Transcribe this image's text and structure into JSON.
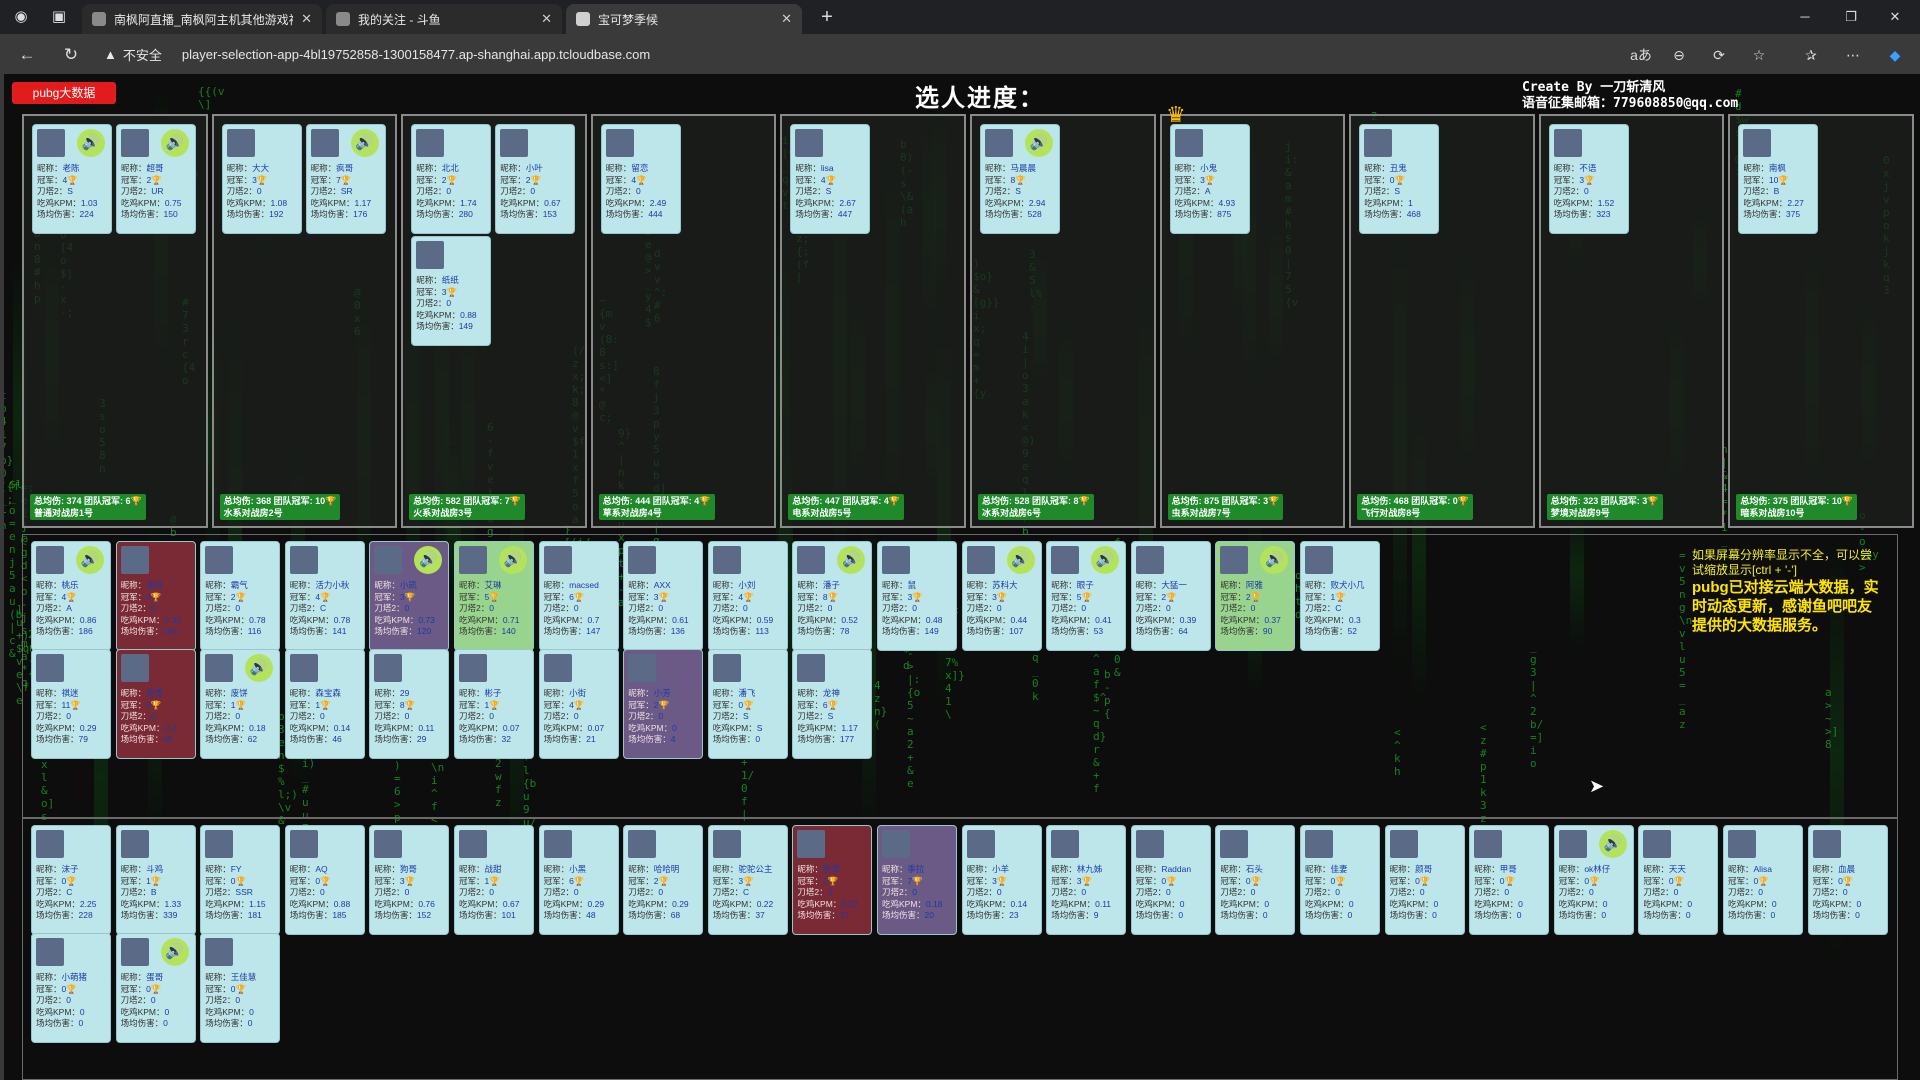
{
  "browser": {
    "tabs": [
      {
        "title": "南枫阿直播_南枫阿主机其他游戏视",
        "active": false
      },
      {
        "title": "我的关注 - 斗鱼",
        "active": false
      },
      {
        "title": "宝可梦季候",
        "active": true
      }
    ],
    "insecure_label": "不安全",
    "url": "player-selection-app-4bl19752858-1300158477.ap-shanghai.app.tcloudbase.com",
    "reader_label": "aあ"
  },
  "page": {
    "pubg_button": "pubg大数据",
    "heading": "选人进度：",
    "credit_line1": "Create By 一刀斩清风",
    "credit_line2": "语音征集邮箱：779608850@qq.com",
    "notice_line": "如果屏幕分辨率显示不全，可以尝试缩放显示[ctrl + '-']",
    "notice_big": "pubg已对接云端大数据，实时动态更新，感谢鱼吧吧友提供的大数据服务。",
    "colors": {
      "accent_green": "#1e8a2a",
      "card_bg": "#bde6ea",
      "pubg_red": "#e21c1c"
    }
  },
  "labels": {
    "nick": "昵称：",
    "crown": "冠军：",
    "tower": "刀塔2：",
    "kpm": "吃鸡KPM：",
    "dmg": "场均伤害："
  },
  "teams": [
    {
      "footer": "总均伤: 374 团队冠军: 6🏆",
      "name": "普通对战房1号",
      "players": [
        {
          "nick": "老陈",
          "crown": "4",
          "tower": "S",
          "kpm": "1.03",
          "dmg": "224",
          "voice": true
        },
        {
          "nick": "超哥",
          "crown": "2",
          "tower": "UR",
          "kpm": "0.75",
          "dmg": "150",
          "voice": true
        }
      ]
    },
    {
      "footer": "总均伤: 368 团队冠军: 10🏆",
      "name": "水系对战房2号",
      "players": [
        {
          "nick": "大大",
          "crown": "3",
          "tower": "0",
          "kpm": "1.08",
          "dmg": "192",
          "voice": false
        },
        {
          "nick": "疯哥",
          "crown": "7",
          "tower": "SR",
          "kpm": "1.17",
          "dmg": "176",
          "voice": true
        }
      ]
    },
    {
      "footer": "总均伤: 582 团队冠军: 7🏆",
      "name": "火系对战房3号",
      "players": [
        {
          "nick": "北北",
          "crown": "2",
          "tower": "0",
          "kpm": "1.74",
          "dmg": "280",
          "voice": false
        },
        {
          "nick": "小叶",
          "crown": "2",
          "tower": "0",
          "kpm": "0.67",
          "dmg": "153",
          "voice": false
        },
        {
          "nick": "纸纸",
          "crown": "3",
          "tower": "0",
          "kpm": "0.88",
          "dmg": "149",
          "voice": false
        }
      ]
    },
    {
      "footer": "总均伤: 444 团队冠军: 4🏆",
      "name": "草系对战房4号",
      "players": [
        {
          "nick": "留恋",
          "crown": "4",
          "tower": "0",
          "kpm": "2.49",
          "dmg": "444",
          "voice": false
        }
      ]
    },
    {
      "footer": "总均伤: 447 团队冠军: 4🏆",
      "name": "电系对战房5号",
      "players": [
        {
          "nick": "lisa",
          "crown": "4",
          "tower": "S",
          "kpm": "2.67",
          "dmg": "447",
          "voice": false
        }
      ]
    },
    {
      "footer": "总均伤: 528 团队冠军: 8🏆",
      "name": "冰系对战房6号",
      "players": [
        {
          "nick": "马晨晨",
          "crown": "8",
          "tower": "S",
          "kpm": "2.94",
          "dmg": "528",
          "voice": true
        }
      ]
    },
    {
      "footer": "总均伤: 875 团队冠军: 3🏆",
      "name": "虫系对战房7号",
      "players": [
        {
          "nick": "小鬼",
          "crown": "3",
          "tower": "A",
          "kpm": "4.93",
          "dmg": "875",
          "voice": false
        }
      ]
    },
    {
      "footer": "总均伤: 468 团队冠军: 0🏆",
      "name": "飞行对战房8号",
      "players": [
        {
          "nick": "丑鬼",
          "crown": "0",
          "tower": "S",
          "kpm": "1",
          "dmg": "468",
          "voice": false
        }
      ]
    },
    {
      "footer": "总均伤: 323 团队冠军: 3🏆",
      "name": "梦境对战房9号",
      "players": [
        {
          "nick": "不语",
          "crown": "3",
          "tower": "0",
          "kpm": "1.52",
          "dmg": "323",
          "voice": false
        }
      ]
    },
    {
      "footer": "总均伤: 375 团队冠军: 10🏆",
      "name": "暗系对战房10号",
      "players": [
        {
          "nick": "南枫",
          "crown": "10",
          "tower": "B",
          "kpm": "2.27",
          "dmg": "375",
          "voice": false
        }
      ]
    }
  ],
  "pool": [
    {
      "nick": "桃乐",
      "crown": "4",
      "tower": "A",
      "kpm": "0.86",
      "dmg": "186",
      "voice": true
    },
    {
      "nick": "电竞",
      "crown": "6",
      "tower": "0",
      "kpm": "0.35",
      "dmg": "166",
      "voice": false,
      "style": "dark"
    },
    {
      "nick": "霸气",
      "crown": "2",
      "tower": "0",
      "kpm": "0.78",
      "dmg": "116",
      "voice": false
    },
    {
      "nick": "活力小秋",
      "crown": "4",
      "tower": "C",
      "kpm": "0.78",
      "dmg": "141",
      "voice": false
    },
    {
      "nick": "小凯",
      "crown": "3",
      "tower": "0",
      "kpm": "0.73",
      "dmg": "120",
      "voice": true,
      "style": "purple"
    },
    {
      "nick": "艾琳",
      "crown": "5",
      "tower": "0",
      "kpm": "0.71",
      "dmg": "140",
      "voice": true,
      "style": "green"
    },
    {
      "nick": "macsed",
      "crown": "6",
      "tower": "0",
      "kpm": "0.7",
      "dmg": "147",
      "voice": false
    },
    {
      "nick": "AXX",
      "crown": "3",
      "tower": "0",
      "kpm": "0.61",
      "dmg": "136",
      "voice": false
    },
    {
      "nick": "小刘",
      "crown": "4",
      "tower": "0",
      "kpm": "0.59",
      "dmg": "113",
      "voice": false
    },
    {
      "nick": "潘子",
      "crown": "8",
      "tower": "0",
      "kpm": "0.52",
      "dmg": "78",
      "voice": true
    },
    {
      "nick": "鼠",
      "crown": "3",
      "tower": "0",
      "kpm": "0.48",
      "dmg": "149",
      "voice": false
    },
    {
      "nick": "苏科大",
      "crown": "3",
      "tower": "0",
      "kpm": "0.44",
      "dmg": "107",
      "voice": true
    },
    {
      "nick": "眼子",
      "crown": "5",
      "tower": "0",
      "kpm": "0.41",
      "dmg": "53",
      "voice": true
    },
    {
      "nick": "大猛一",
      "crown": "2",
      "tower": "0",
      "kpm": "0.39",
      "dmg": "64",
      "voice": false
    },
    {
      "nick": "阿雅",
      "crown": "2",
      "tower": "0",
      "kpm": "0.37",
      "dmg": "90",
      "voice": true,
      "style": "green"
    },
    {
      "nick": "败犬小几",
      "crown": "1",
      "tower": "C",
      "kpm": "0.3",
      "dmg": "52",
      "voice": false
    },
    {
      "nick": "祺迷",
      "crown": "11",
      "tower": "0",
      "kpm": "0.29",
      "dmg": "79",
      "voice": false
    },
    {
      "nick": "炬哥",
      "crown": "3",
      "tower": "0",
      "kpm": "0.2",
      "dmg": "46",
      "voice": false,
      "style": "dark"
    },
    {
      "nick": "废饼",
      "crown": "1",
      "tower": "0",
      "kpm": "0.18",
      "dmg": "62",
      "voice": true
    },
    {
      "nick": "森宝森",
      "crown": "1",
      "tower": "0",
      "kpm": "0.14",
      "dmg": "46",
      "voice": false
    },
    {
      "nick": "29",
      "crown": "8",
      "tower": "0",
      "kpm": "0.11",
      "dmg": "29",
      "voice": false
    },
    {
      "nick": "彬子",
      "crown": "1",
      "tower": "0",
      "kpm": "0.07",
      "dmg": "32",
      "voice": false
    },
    {
      "nick": "小街",
      "crown": "4",
      "tower": "0",
      "kpm": "0.07",
      "dmg": "21",
      "voice": false
    },
    {
      "nick": "小芳",
      "crown": "2",
      "tower": "0",
      "kpm": "0",
      "dmg": "4",
      "voice": false,
      "style": "purple"
    },
    {
      "nick": "潘飞",
      "crown": "0",
      "tower": "S",
      "kpm": "S",
      "dmg": "0",
      "voice": false
    },
    {
      "nick": "龙神",
      "crown": "6",
      "tower": "S",
      "kpm": "1.17",
      "dmg": "177",
      "voice": false
    }
  ],
  "pool2": [
    {
      "nick": "沫子",
      "crown": "0",
      "tower": "C",
      "kpm": "2.25",
      "dmg": "228",
      "voice": false
    },
    {
      "nick": "斗鸡",
      "crown": "1",
      "tower": "B",
      "kpm": "1.33",
      "dmg": "339",
      "voice": false
    },
    {
      "nick": "FY",
      "crown": "0",
      "tower": "SSR",
      "kpm": "1.15",
      "dmg": "181",
      "voice": false
    },
    {
      "nick": "AQ",
      "crown": "0",
      "tower": "0",
      "kpm": "0.88",
      "dmg": "185",
      "voice": false
    },
    {
      "nick": "狗哥",
      "crown": "3",
      "tower": "0",
      "kpm": "0.76",
      "dmg": "152",
      "voice": false
    },
    {
      "nick": "战甜",
      "crown": "1",
      "tower": "0",
      "kpm": "0.67",
      "dmg": "101",
      "voice": false
    },
    {
      "nick": "小黑",
      "crown": "6",
      "tower": "0",
      "kpm": "0.29",
      "dmg": "48",
      "voice": false
    },
    {
      "nick": "哈哈明",
      "crown": "2",
      "tower": "0",
      "kpm": "0.29",
      "dmg": "68",
      "voice": false
    },
    {
      "nick": "驼驼公主",
      "crown": "3",
      "tower": "C",
      "kpm": "0.22",
      "dmg": "37",
      "voice": false
    },
    {
      "nick": "驼哥",
      "crown": "2",
      "tower": "0",
      "kpm": "0.22",
      "dmg": "27",
      "voice": false,
      "style": "dark"
    },
    {
      "nick": "季拉",
      "crown": "7",
      "tower": "0",
      "kpm": "0.18",
      "dmg": "20",
      "voice": false,
      "style": "purple"
    },
    {
      "nick": "小羊",
      "crown": "3",
      "tower": "0",
      "kpm": "0.14",
      "dmg": "23",
      "voice": false
    },
    {
      "nick": "林九姊",
      "crown": "3",
      "tower": "0",
      "kpm": "0.11",
      "dmg": "9",
      "voice": false
    },
    {
      "nick": "Raddan",
      "crown": "0",
      "tower": "0",
      "kpm": "0",
      "dmg": "0",
      "voice": false
    },
    {
      "nick": "石头",
      "crown": "0",
      "tower": "0",
      "kpm": "0",
      "dmg": "0",
      "voice": false
    },
    {
      "nick": "佳妻",
      "crown": "0",
      "tower": "0",
      "kpm": "0",
      "dmg": "0",
      "voice": false
    },
    {
      "nick": "颜哥",
      "crown": "0",
      "tower": "0",
      "kpm": "0",
      "dmg": "0",
      "voice": false
    },
    {
      "nick": "甲哥",
      "crown": "0",
      "tower": "0",
      "kpm": "0",
      "dmg": "0",
      "voice": false
    },
    {
      "nick": "ok林仔",
      "crown": "0",
      "tower": "0",
      "kpm": "0",
      "dmg": "0",
      "voice": true
    },
    {
      "nick": "天天",
      "crown": "0",
      "tower": "0",
      "kpm": "0",
      "dmg": "0",
      "voice": false
    },
    {
      "nick": "Alisa",
      "crown": "0",
      "tower": "0",
      "kpm": "0",
      "dmg": "0",
      "voice": false
    },
    {
      "nick": "血晨",
      "crown": "0",
      "tower": "0",
      "kpm": "0",
      "dmg": "0",
      "voice": false
    },
    {
      "nick": "小萌猪",
      "crown": "0",
      "tower": "0",
      "kpm": "0",
      "dmg": "0",
      "voice": false
    },
    {
      "nick": "蛋哥",
      "crown": "0",
      "tower": "0",
      "kpm": "0",
      "dmg": "0",
      "voice": true
    },
    {
      "nick": "王佳慧",
      "crown": "0",
      "tower": "0",
      "kpm": "0",
      "dmg": "0",
      "voice": false
    }
  ]
}
